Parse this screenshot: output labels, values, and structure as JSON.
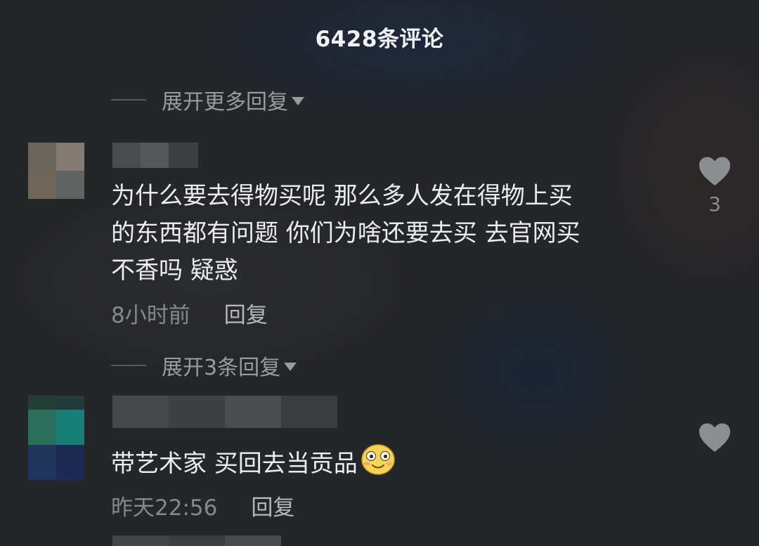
{
  "header": {
    "title": "6428条评论"
  },
  "expand_rows": [
    {
      "label": "展开更多回复"
    },
    {
      "label": "展开3条回复"
    }
  ],
  "comments": [
    {
      "lines": [
        "为什么要去得物买呢 那么多人发在得物上买",
        "的东西都有问题 你们为啥还要去买 去官网买",
        "不香吗 疑惑"
      ],
      "time": "8小时前",
      "reply_label": "回复",
      "like_count": "3",
      "avatar_colors": [
        "#6b655e",
        "#857a73",
        "#706658",
        "#5f6462"
      ]
    },
    {
      "text": "带艺术家 买回去当贡品",
      "emoji": "smiley-emoji",
      "time": "昨天22:56",
      "reply_label": "回复",
      "like_count": "",
      "avatar_colors": [
        "#2a6e5a",
        "#1a7e78",
        "#20345c",
        "#1c2a54"
      ]
    }
  ],
  "icons": {
    "like": "heart-icon",
    "expand": "caret-down-icon"
  }
}
